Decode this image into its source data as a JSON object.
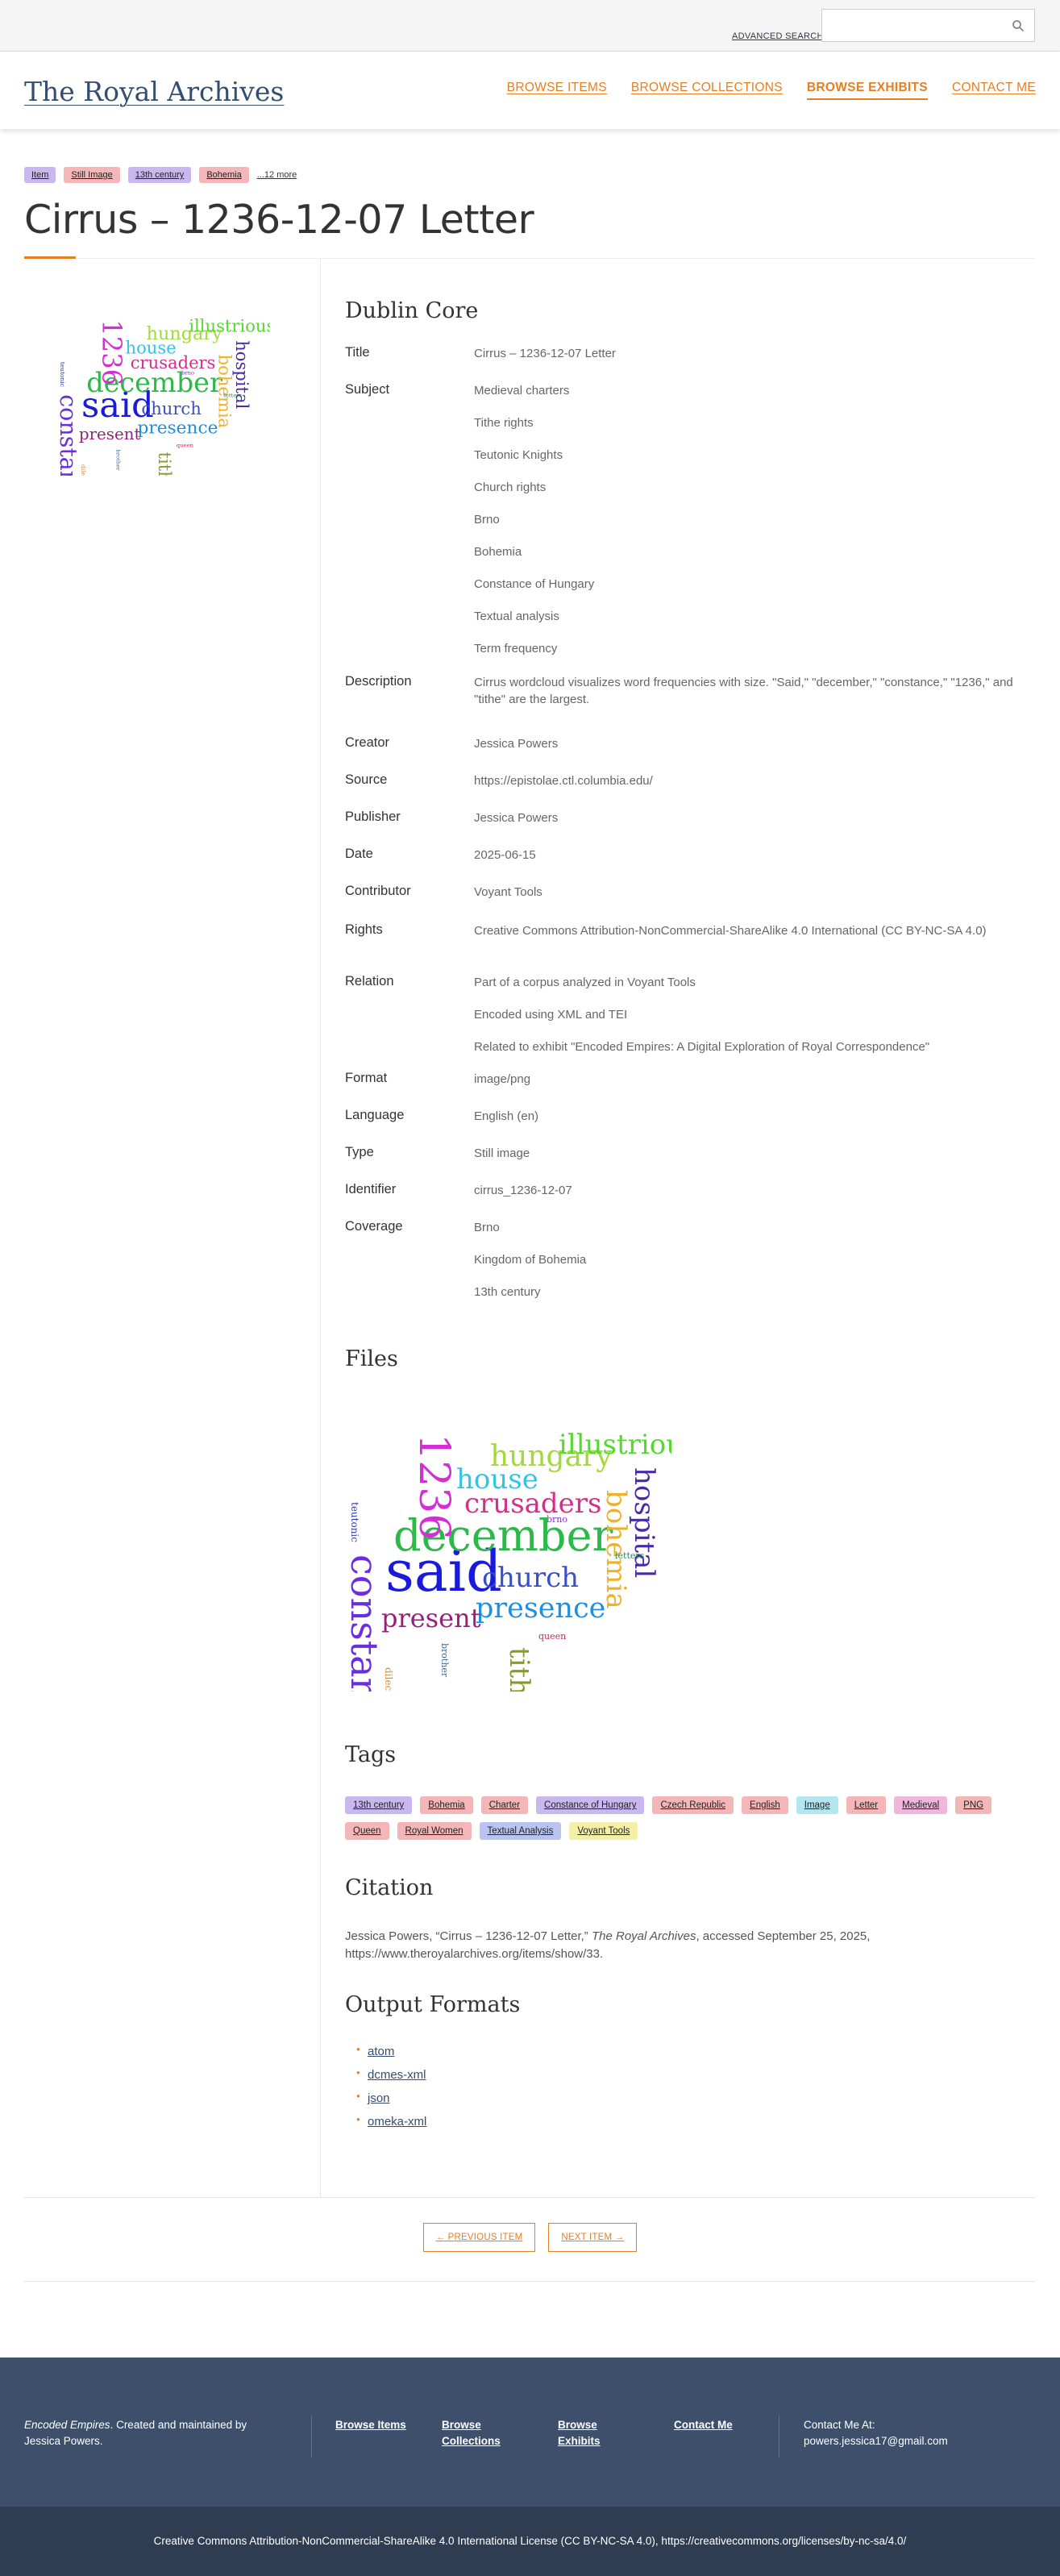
{
  "topbar": {
    "advanced_search": "ADVANCED SEARCH",
    "search_placeholder": "",
    "search_icon": "search-icon"
  },
  "header": {
    "site_title": "The Royal Archives",
    "nav": [
      "BROWSE ITEMS",
      "BROWSE COLLECTIONS",
      "BROWSE EXHIBITS",
      "CONTACT ME"
    ],
    "active_nav": "BROWSE EXHIBITS"
  },
  "colors": {
    "accent": "#e67e22",
    "link": "#334e6e",
    "footer": "#3d4f6b",
    "footer_bottom": "#2f3d53"
  },
  "badges": {
    "items": [
      {
        "label": "Item",
        "color": "#c9b7f0"
      },
      {
        "label": "Still Image",
        "color": "#f4b6b6"
      },
      {
        "label": "13th century",
        "color": "#c9b7f0"
      },
      {
        "label": "Bohemia",
        "color": "#f4b6b6"
      }
    ],
    "more": "...12 more"
  },
  "page_title": "Cirrus – 1236-12-07 Letter",
  "dublin_core": {
    "heading": "Dublin Core",
    "fields": [
      {
        "label": "Title",
        "values": [
          "Cirrus – 1236-12-07 Letter"
        ]
      },
      {
        "label": "Subject",
        "values": [
          "Medieval charters",
          "Tithe rights",
          "Teutonic Knights",
          "Church rights",
          "Brno",
          "Bohemia",
          "Constance of Hungary",
          "Textual analysis",
          "Term frequency"
        ]
      },
      {
        "label": "Description",
        "values": [
          "Cirrus wordcloud visualizes word frequencies with size. \"Said,\" \"december,\" \"constance,\" \"1236,\" and \"tithe\" are the largest."
        ]
      },
      {
        "label": "Creator",
        "values": [
          "Jessica Powers"
        ]
      },
      {
        "label": "Source",
        "values": [
          "https://epistolae.ctl.columbia.edu/"
        ]
      },
      {
        "label": "Publisher",
        "values": [
          "Jessica Powers"
        ]
      },
      {
        "label": "Date",
        "values": [
          "2025-06-15"
        ]
      },
      {
        "label": "Contributor",
        "values": [
          "Voyant Tools"
        ]
      },
      {
        "label": "Rights",
        "values": [
          "Creative Commons Attribution-NonCommercial-ShareAlike 4.0 International (CC BY-NC-SA 4.0)"
        ]
      },
      {
        "label": "Relation",
        "values": [
          "Part of a corpus analyzed in Voyant Tools",
          "Encoded using XML and TEI",
          "Related to exhibit \"Encoded Empires: A Digital Exploration of Royal Correspondence\""
        ]
      },
      {
        "label": "Format",
        "values": [
          "image/png"
        ]
      },
      {
        "label": "Language",
        "values": [
          "English (en)"
        ]
      },
      {
        "label": "Type",
        "values": [
          "Still image"
        ]
      },
      {
        "label": "Identifier",
        "values": [
          "cirrus_1236-12-07"
        ]
      },
      {
        "label": "Coverage",
        "values": [
          "Brno",
          "Kingdom of Bohemia",
          "13th century"
        ]
      }
    ]
  },
  "files": {
    "heading": "Files"
  },
  "wordcloud": {
    "words": [
      {
        "text": "constance",
        "color": "#6a2ee0"
      },
      {
        "text": "said",
        "color": "#1a1adb"
      },
      {
        "text": "december",
        "color": "#2db84a"
      },
      {
        "text": "1236",
        "color": "#d42fd4"
      },
      {
        "text": "presence",
        "color": "#1f8fe0"
      },
      {
        "text": "present",
        "color": "#9b1f7a"
      },
      {
        "text": "church",
        "color": "#3b4fc4"
      },
      {
        "text": "crusaders",
        "color": "#d42f8a"
      },
      {
        "text": "house",
        "color": "#33c3e8"
      },
      {
        "text": "hungary",
        "color": "#a3d93b"
      },
      {
        "text": "illustrious",
        "color": "#55d92e"
      },
      {
        "text": "hospital",
        "color": "#4b2aa8"
      },
      {
        "text": "bohemia",
        "color": "#f0b129"
      },
      {
        "text": "tithe",
        "color": "#8a9a2a"
      },
      {
        "text": "teutonic",
        "color": "#2a3aa8"
      },
      {
        "text": "dilectus",
        "color": "#e08a2a"
      },
      {
        "text": "brother",
        "color": "#3a6a9a"
      },
      {
        "text": "queen",
        "color": "#c22a5a"
      },
      {
        "text": "brno",
        "color": "#8a2ad8"
      },
      {
        "text": "letters",
        "color": "#2a8a6a"
      }
    ]
  },
  "tags": {
    "heading": "Tags",
    "items": [
      {
        "label": "13th century",
        "color": "#c9b7f0"
      },
      {
        "label": "Bohemia",
        "color": "#f4b6b6"
      },
      {
        "label": "Charter",
        "color": "#f4b6b6"
      },
      {
        "label": "Constance of Hungary",
        "color": "#c9b7f0"
      },
      {
        "label": "Czech Republic",
        "color": "#f4b6b6"
      },
      {
        "label": "English",
        "color": "#f4b6b6"
      },
      {
        "label": "Image",
        "color": "#b4e6f0"
      },
      {
        "label": "Letter",
        "color": "#f4b6b6"
      },
      {
        "label": "Medieval",
        "color": "#f0b6dc"
      },
      {
        "label": "PNG",
        "color": "#f4b6b6"
      },
      {
        "label": "Queen",
        "color": "#f4b6b6"
      },
      {
        "label": "Royal Women",
        "color": "#f4b6b6"
      },
      {
        "label": "Textual Analysis",
        "color": "#b9c4f0"
      },
      {
        "label": "Voyant Tools",
        "color": "#f4f0a8"
      }
    ]
  },
  "citation": {
    "heading": "Citation",
    "before": "Jessica Powers, “Cirrus – 1236-12-07 Letter,” ",
    "site": "The Royal Archives",
    "after": ", accessed September 25, 2025, https://www.theroyalarchives.org/items/show/33."
  },
  "output_formats": {
    "heading": "Output Formats",
    "items": [
      "atom",
      "dcmes-xml",
      "json",
      "omeka-xml"
    ]
  },
  "pager": {
    "prev": "← PREVIOUS ITEM",
    "next": "NEXT ITEM →"
  },
  "footer": {
    "about_em": "Encoded Empires",
    "about_rest": ". Created and maintained by Jessica Powers.",
    "links": [
      "Browse Items",
      "Browse Collections",
      "Browse Exhibits",
      "Contact Me"
    ],
    "contact_label": "Contact Me At:",
    "contact_email": "powers.jessica17@gmail.com",
    "license": "Creative Commons Attribution-NonCommercial-ShareAlike 4.0 International License (CC BY-NC-SA 4.0), https://creativecommons.org/licenses/by-nc-sa/4.0/"
  }
}
